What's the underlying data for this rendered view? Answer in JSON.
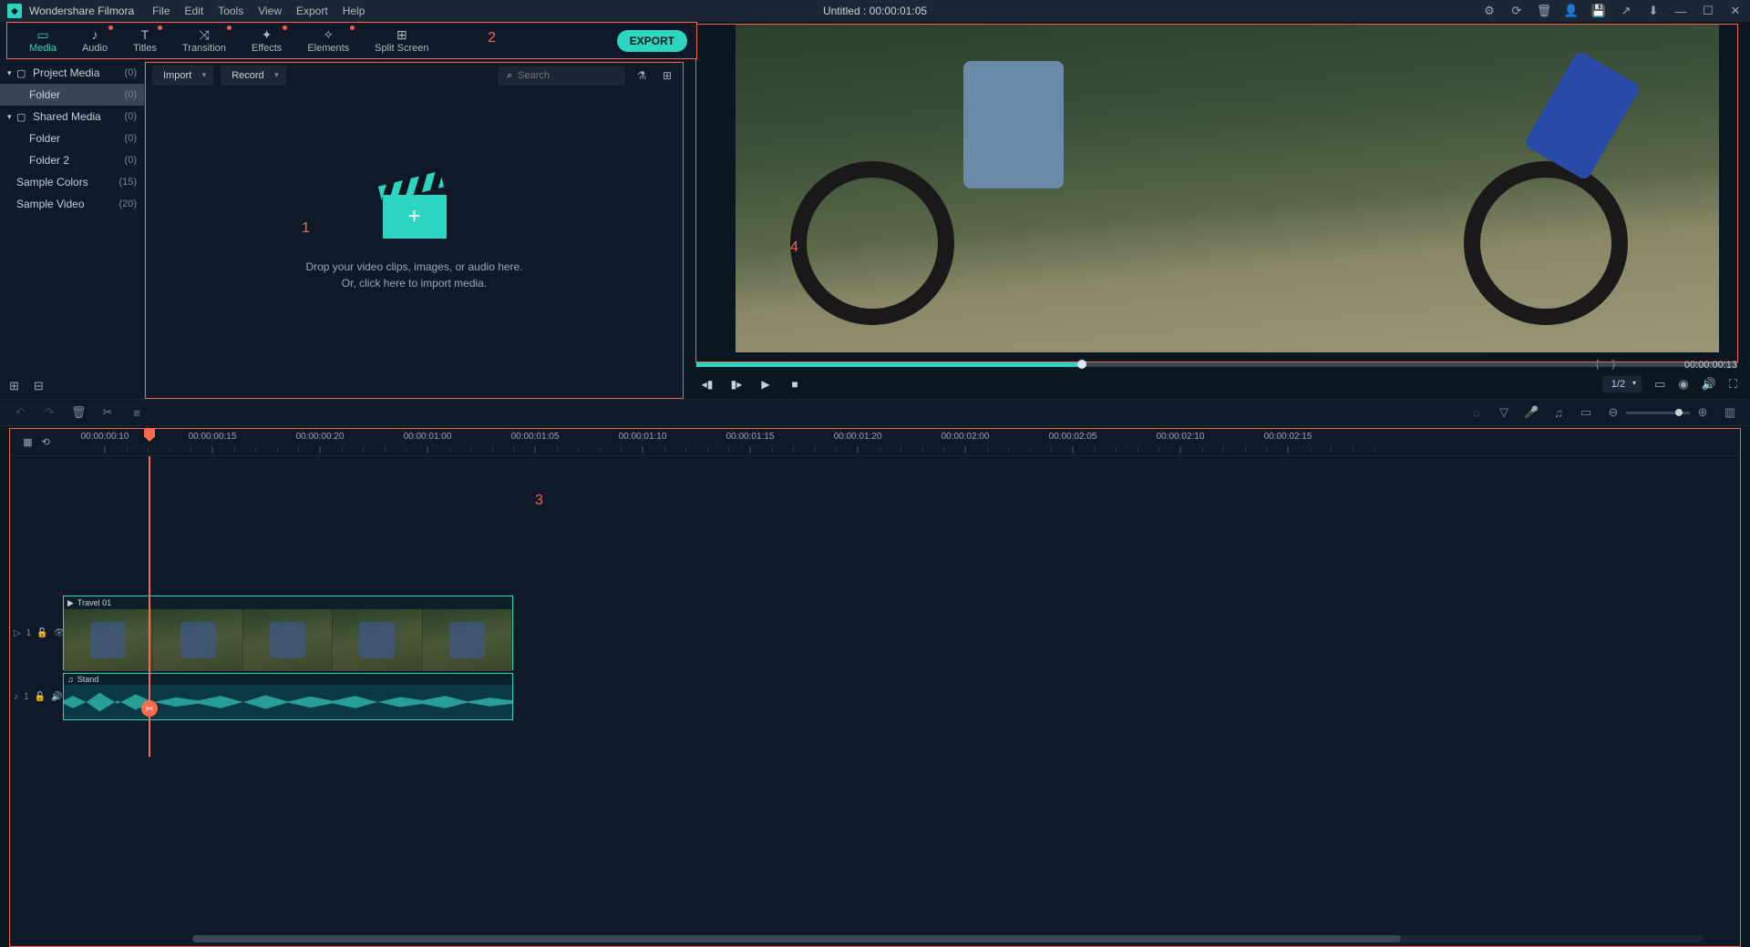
{
  "titlebar": {
    "app_name": "Wondershare Filmora",
    "menus": [
      "File",
      "Edit",
      "Tools",
      "View",
      "Export",
      "Help"
    ],
    "document": "Untitled : 00:00:01:05"
  },
  "toolbar": {
    "items": [
      {
        "label": "Media",
        "active": true,
        "dot": false
      },
      {
        "label": "Audio",
        "active": false,
        "dot": true
      },
      {
        "label": "Titles",
        "active": false,
        "dot": true
      },
      {
        "label": "Transition",
        "active": false,
        "dot": true
      },
      {
        "label": "Effects",
        "active": false,
        "dot": true
      },
      {
        "label": "Elements",
        "active": false,
        "dot": true
      },
      {
        "label": "Split Screen",
        "active": false,
        "dot": false
      }
    ],
    "export_label": "EXPORT"
  },
  "sidebar": {
    "rows": [
      {
        "name": "Project Media",
        "count": "(0)",
        "chev": "▾",
        "fold": true,
        "indent": false,
        "selected": false
      },
      {
        "name": "Folder",
        "count": "(0)",
        "chev": "",
        "fold": false,
        "indent": true,
        "selected": true
      },
      {
        "name": "Shared Media",
        "count": "(0)",
        "chev": "▾",
        "fold": true,
        "indent": false,
        "selected": false
      },
      {
        "name": "Folder",
        "count": "(0)",
        "chev": "",
        "fold": false,
        "indent": true,
        "selected": false
      },
      {
        "name": "Folder 2",
        "count": "(0)",
        "chev": "",
        "fold": false,
        "indent": true,
        "selected": false
      },
      {
        "name": "Sample Colors",
        "count": "(15)",
        "chev": "",
        "fold": false,
        "indent": false,
        "selected": false,
        "noindent": true
      },
      {
        "name": "Sample Video",
        "count": "(20)",
        "chev": "",
        "fold": false,
        "indent": false,
        "selected": false,
        "noindent": true
      }
    ]
  },
  "media": {
    "import_label": "Import",
    "record_label": "Record",
    "search_placeholder": "Search",
    "drop_line1": "Drop your video clips, images, or audio here.",
    "drop_line2": "Or, click here to import media."
  },
  "preview": {
    "elapsed": "00:00:00:13",
    "ratio": "1/2"
  },
  "timeline": {
    "majors": [
      "00:00:00:10",
      "00:00:00:15",
      "00:00:00:20",
      "00:00:01:00",
      "00:00:01:05",
      "00:00:01:10",
      "00:00:01:15",
      "00:00:01:20",
      "00:00:02:00",
      "00:00:02:05",
      "00:00:02:10",
      "00:00:02:15"
    ],
    "video_clip_name": "Travel 01",
    "audio_clip_name": "Stand",
    "video_track_label": "1",
    "audio_track_label": "1"
  },
  "annotations": {
    "a1": "1",
    "a2": "2",
    "a3": "3",
    "a4": "4"
  }
}
